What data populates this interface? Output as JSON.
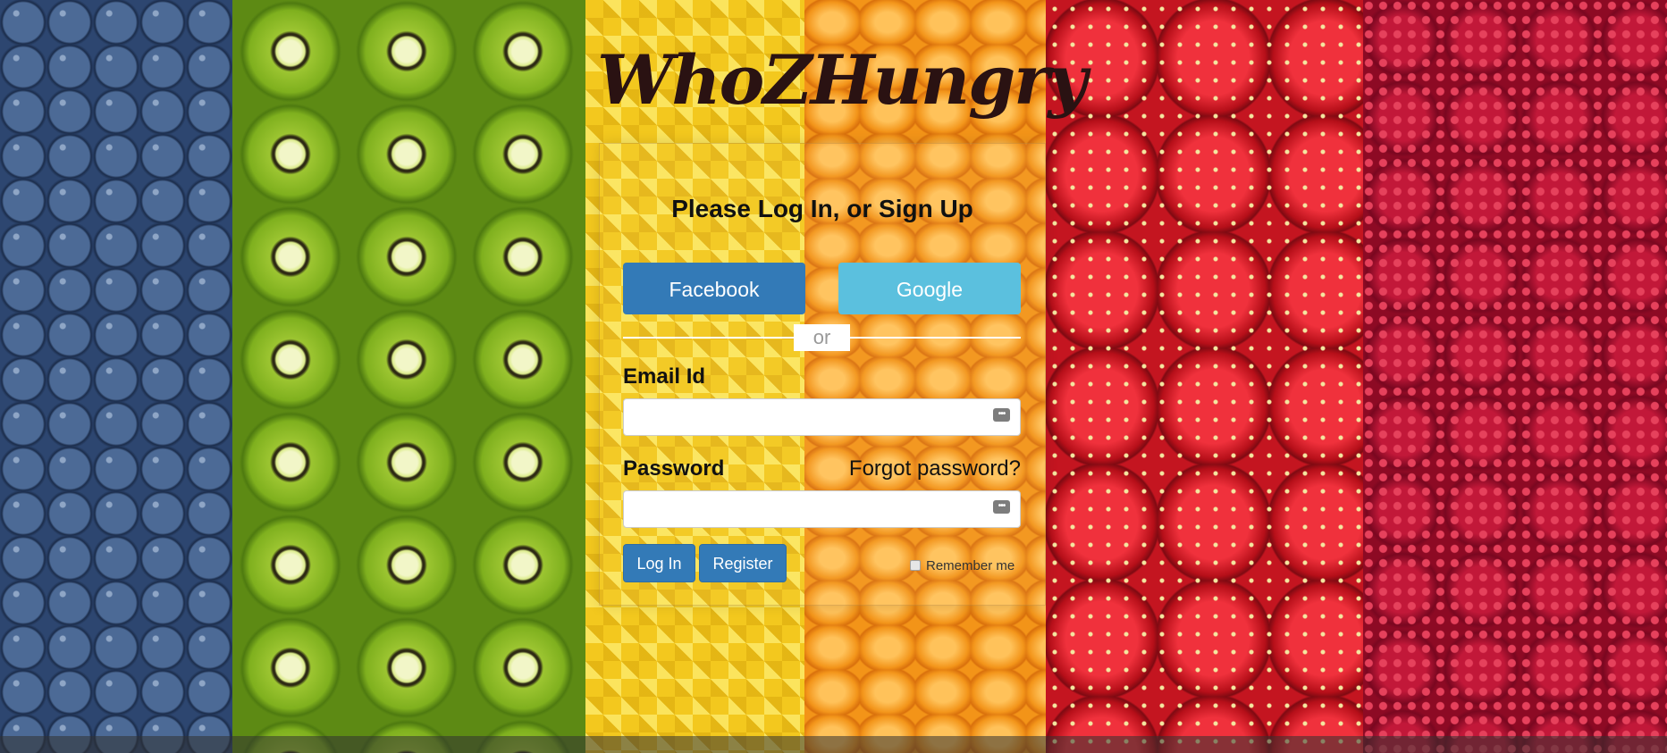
{
  "brand": {
    "name": "WhoZHungry"
  },
  "login": {
    "title": "Please Log In, or Sign Up",
    "facebook_label": "Facebook",
    "google_label": "Google",
    "divider_text": "or",
    "email_label": "Email Id",
    "email_value": "",
    "password_label": "Password",
    "password_value": "",
    "forgot_label": "Forgot password?",
    "login_label": "Log In",
    "register_label": "Register",
    "remember_label": "Remember me",
    "remember_checked": false,
    "key_icon_glyph": "•••"
  },
  "colors": {
    "primary": "#337ab7",
    "google": "#5bc0de",
    "brand_text": "#2a1212"
  },
  "background": {
    "image": "fruit-stripes"
  }
}
